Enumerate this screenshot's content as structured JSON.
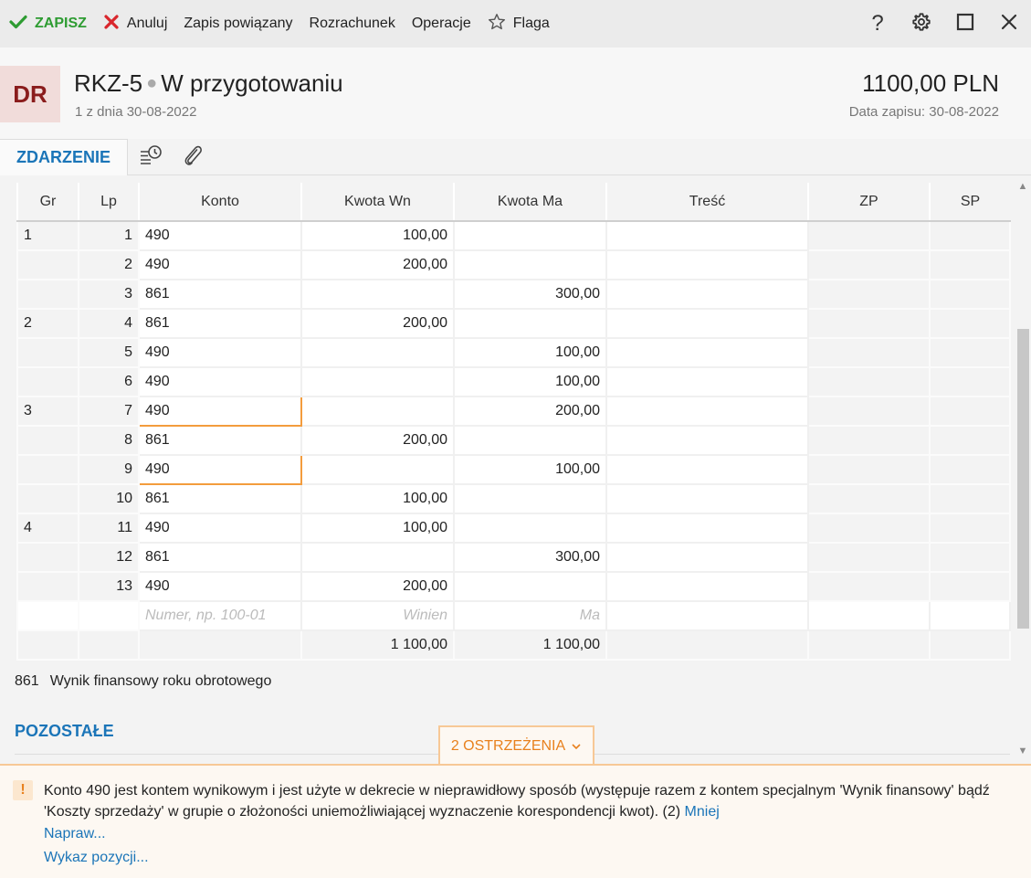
{
  "toolbar": {
    "save_label": "ZAPISZ",
    "cancel_label": "Anuluj",
    "linked_label": "Zapis powiązany",
    "settlement_label": "Rozrachunek",
    "operations_label": "Operacje",
    "flag_label": "Flaga",
    "help_label": "?",
    "icons": [
      "check-icon",
      "x-icon",
      "star-icon",
      "gear-icon",
      "maximize-icon",
      "close-icon"
    ],
    "colors": {
      "save": "#2e9c32",
      "cancel": "#d9262c"
    }
  },
  "header": {
    "avatar": "DR",
    "doc_number": "RKZ-5",
    "status": "W przygotowaniu",
    "subtitle": "1 z dnia 30-08-2022",
    "amount": "1100,00 PLN",
    "date_label": "Data zapisu: 30-08-2022"
  },
  "tabs": {
    "active": "ZDARZENIE",
    "icons": [
      "history-icon",
      "paperclip-icon"
    ]
  },
  "grid": {
    "columns": [
      "Gr",
      "Lp",
      "Konto",
      "Kwota Wn",
      "Kwota Ma",
      "Treść",
      "ZP",
      "SP"
    ],
    "rows": [
      {
        "gr": "1",
        "lp": "1",
        "konto": "490",
        "wn": "100,00",
        "ma": ""
      },
      {
        "gr": "",
        "lp": "2",
        "konto": "490",
        "wn": "200,00",
        "ma": ""
      },
      {
        "gr": "",
        "lp": "3",
        "konto": "861",
        "wn": "",
        "ma": "300,00"
      },
      {
        "gr": "2",
        "lp": "4",
        "konto": "861",
        "wn": "200,00",
        "ma": ""
      },
      {
        "gr": "",
        "lp": "5",
        "konto": "490",
        "wn": "",
        "ma": "100,00"
      },
      {
        "gr": "",
        "lp": "6",
        "konto": "490",
        "wn": "",
        "ma": "100,00"
      },
      {
        "gr": "3",
        "lp": "7",
        "konto": "490",
        "wn": "",
        "ma": "200,00"
      },
      {
        "gr": "",
        "lp": "8",
        "konto": "861",
        "wn": "200,00",
        "ma": ""
      },
      {
        "gr": "",
        "lp": "9",
        "konto": "490",
        "wn": "",
        "ma": "100,00"
      },
      {
        "gr": "",
        "lp": "10",
        "konto": "861",
        "wn": "100,00",
        "ma": ""
      },
      {
        "gr": "4",
        "lp": "11",
        "konto": "490",
        "wn": "100,00",
        "ma": ""
      },
      {
        "gr": "",
        "lp": "12",
        "konto": "861",
        "wn": "",
        "ma": "300,00"
      },
      {
        "gr": "",
        "lp": "13",
        "konto": "490",
        "wn": "200,00",
        "ma": ""
      }
    ],
    "new_row": {
      "konto_placeholder": "Numer, np. 100-01",
      "wn_placeholder": "Winien",
      "ma_placeholder": "Ma"
    },
    "totals": {
      "wn": "1 100,00",
      "ma": "1 100,00"
    },
    "highlight_color": "#f39c3d"
  },
  "account_description": {
    "code": "861",
    "name": "Wynik finansowy roku obrotowego"
  },
  "section": {
    "title": "POZOSTAŁE"
  },
  "warnings": {
    "tab_label": "2 OSTRZEŻENIA",
    "icon_symbol": "!",
    "message": "Konto 490 jest kontem wynikowym i jest użyte w dekrecie w nieprawidłowy sposób (występuje razem z kontem specjalnym 'Wynik finansowy' bądź 'Koszty sprzedaży' w grupie o złożoności uniemożliwiającej wyznaczenie korespondencji kwot). (2)",
    "less_link": "Mniej",
    "fix_link": "Napraw...",
    "list_link": "Wykaz pozycji...",
    "color": "#e8811e"
  }
}
